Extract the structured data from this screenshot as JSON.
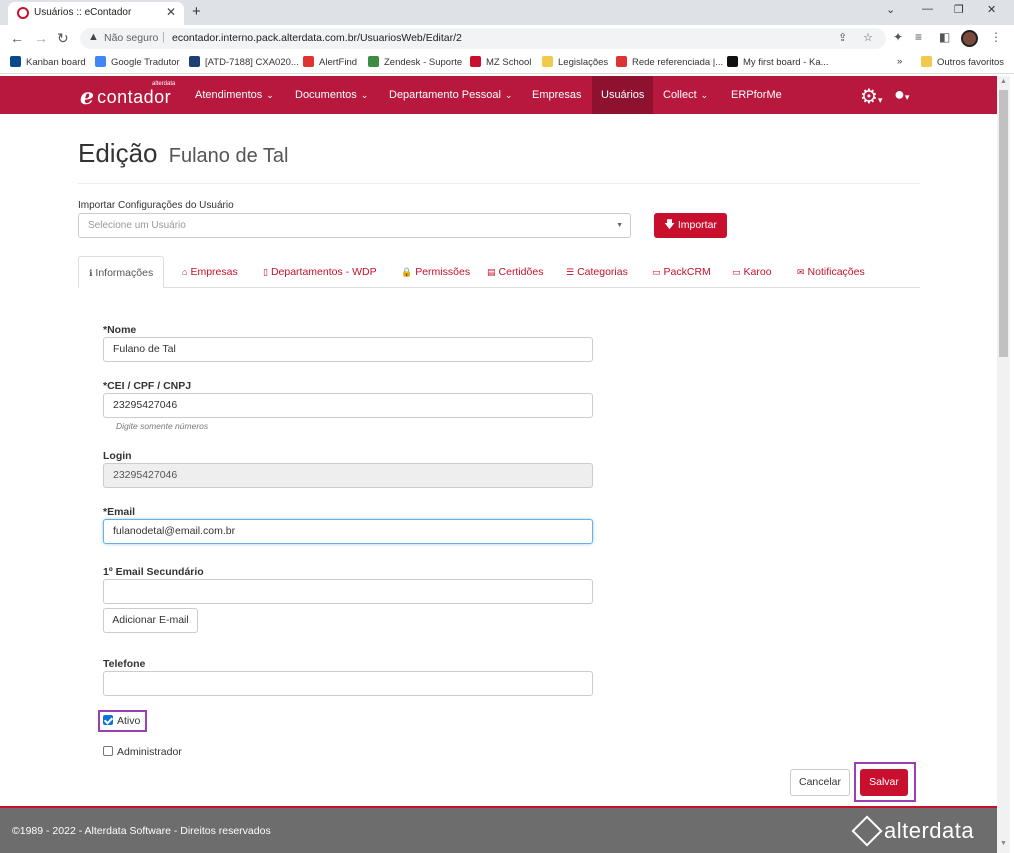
{
  "browser": {
    "tab_title": "Usuários :: eContador",
    "tab_close": "✕",
    "new_tab": "+",
    "not_secure": "Não seguro",
    "url": "econtador.interno.pack.alterdata.com.br/UsuariosWeb/Editar/2",
    "bookmarks": [
      {
        "label": "Kanban board",
        "icon_color": "#0b4a8a"
      },
      {
        "label": "Google Tradutor",
        "icon_color": "#4285f4"
      },
      {
        "label": "[ATD-7188] CXA020...",
        "icon_color": "#1e3f73"
      },
      {
        "label": "AlertFind",
        "icon_color": "#d33"
      },
      {
        "label": "Zendesk - Suporte",
        "icon_color": "#3d8c40"
      },
      {
        "label": "MZ School",
        "icon_color": "#c8102e"
      },
      {
        "label": "Legislações",
        "icon_color": "#f2c94c"
      },
      {
        "label": "Rede referenciada |...",
        "icon_color": "#d33"
      },
      {
        "label": "My first board - Ka...",
        "icon_color": "#111"
      }
    ],
    "bookmarks_more": "»",
    "other_bookmarks": "Outros favoritos"
  },
  "appnav": {
    "logo_small": "alterdata",
    "logo_text": "contador",
    "items": [
      {
        "label": "Atendimentos",
        "caret": true
      },
      {
        "label": "Documentos",
        "caret": true
      },
      {
        "label": "Departamento Pessoal",
        "caret": true
      },
      {
        "label": "Empresas",
        "caret": false
      },
      {
        "label": "Usuários",
        "caret": false,
        "active": true
      },
      {
        "label": "Collect",
        "caret": true
      },
      {
        "label": "ERPforMe",
        "caret": false
      }
    ]
  },
  "page": {
    "title": "Edição",
    "subtitle": "Fulano de Tal",
    "import_label": "Importar Configurações do Usuário",
    "import_placeholder": "Selecione um Usuário",
    "import_button": "Importar",
    "tabs": [
      {
        "label": "Informações",
        "icon": "info-icon",
        "glyph": "ℹ",
        "active": true
      },
      {
        "label": "Empresas",
        "icon": "home-icon",
        "glyph": "⌂"
      },
      {
        "label": "Departamentos - WDP",
        "icon": "tablet-icon",
        "glyph": "▯"
      },
      {
        "label": "Permissões",
        "icon": "lock-icon",
        "glyph": "🔒"
      },
      {
        "label": "Certidões",
        "icon": "file-icon",
        "glyph": "▤"
      },
      {
        "label": "Categorias",
        "icon": "list-icon",
        "glyph": "☰"
      },
      {
        "label": "PackCRM",
        "icon": "monitor-icon",
        "glyph": "▭"
      },
      {
        "label": "Karoo",
        "icon": "monitor-icon",
        "glyph": "▭"
      },
      {
        "label": "Notificações",
        "icon": "envelope-icon",
        "glyph": "✉"
      }
    ],
    "form": {
      "nome_label": "*Nome",
      "nome_value": "Fulano de Tal",
      "cpf_label": "*CEI / CPF / CNPJ",
      "cpf_value": "23295427046",
      "cpf_help": "Digite somente números",
      "login_label": "Login",
      "login_value": "23295427046",
      "email_label": "*Email",
      "email_value": "fulanodetal@email.com.br",
      "email2_label": "1º Email Secundário",
      "email2_value": "",
      "add_email": "Adicionar E-mail",
      "telefone_label": "Telefone",
      "telefone_value": "",
      "ativo_label": "Ativo",
      "ativo_checked": true,
      "admin_label": "Administrador",
      "admin_checked": false
    },
    "cancel": "Cancelar",
    "save": "Salvar"
  },
  "footer": {
    "copyright": "©1989 - 2022 - Alterdata Software - Direitos reservados",
    "logo": "alterdata"
  },
  "colors": {
    "brand": "#b8183e",
    "primary_button": "#c8102e",
    "highlight": "#9b3fb5"
  }
}
